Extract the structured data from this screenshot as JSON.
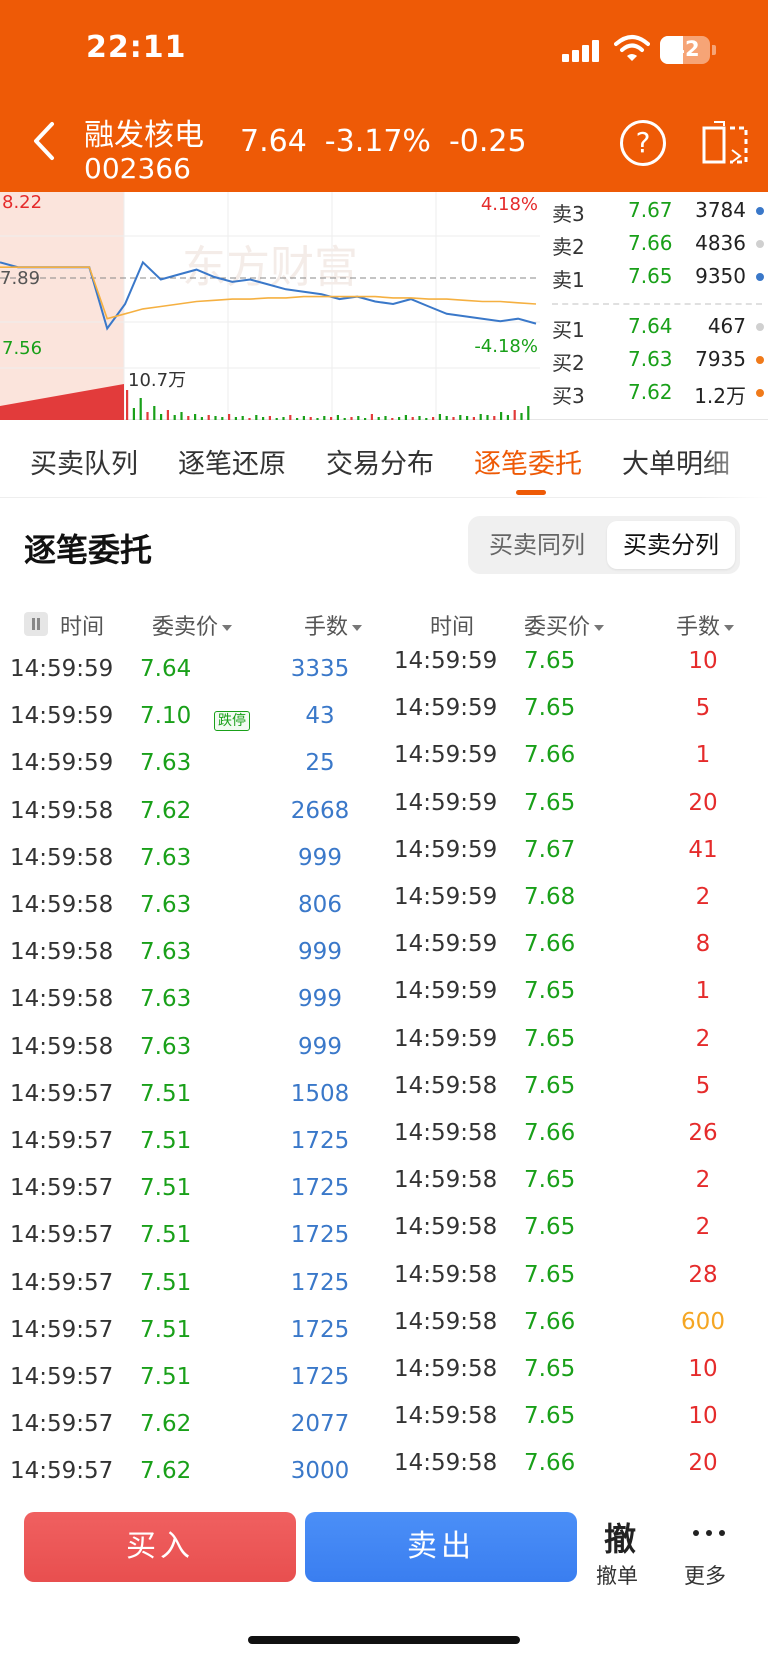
{
  "status_bar": {
    "time": "22:11",
    "battery": "42"
  },
  "header": {
    "stock_name": "融发核电",
    "stock_code": "002366",
    "price": "7.64",
    "change_pct": "-3.17%",
    "change": "-0.25",
    "help_label": "?"
  },
  "mini_chart": {
    "high_price": "8.22",
    "prev_close": "7.89",
    "low_price": "7.56",
    "high_pct": "4.18%",
    "low_pct": "-4.18%",
    "volume_label": "10.7万",
    "watermark": "东方财富"
  },
  "chart_data": {
    "type": "line",
    "ylim": [
      7.56,
      8.22
    ],
    "series": [
      {
        "values": [
          7.95,
          7.93,
          7.93,
          7.93,
          7.93,
          7.93,
          7.68,
          7.78,
          7.95,
          7.88,
          7.9,
          7.92,
          7.89,
          7.87,
          7.88,
          7.86,
          7.84,
          7.83,
          7.82,
          7.8,
          7.81,
          7.79,
          7.78,
          7.8,
          7.77,
          7.74,
          7.73,
          7.72,
          7.71,
          7.72,
          7.7
        ]
      },
      {
        "values": [
          7.93,
          7.93,
          7.93,
          7.93,
          7.93,
          7.93,
          7.72,
          7.74,
          7.76,
          7.77,
          7.78,
          7.79,
          7.795,
          7.8,
          7.8,
          7.805,
          7.805,
          7.81,
          7.81,
          7.81,
          7.81,
          7.81,
          7.805,
          7.805,
          7.8,
          7.8,
          7.795,
          7.79,
          7.79,
          7.785,
          7.78
        ]
      }
    ]
  },
  "order_book": {
    "asks": [
      {
        "label": "卖3",
        "price": "7.67",
        "volume": "3784",
        "dot": "#3a78c9"
      },
      {
        "label": "卖2",
        "price": "7.66",
        "volume": "4836",
        "dot": "#d0d0d0"
      },
      {
        "label": "卖1",
        "price": "7.65",
        "volume": "9350",
        "dot": "#3a78c9"
      }
    ],
    "bids": [
      {
        "label": "买1",
        "price": "7.64",
        "volume": "467",
        "dot": "#d0d0d0"
      },
      {
        "label": "买2",
        "price": "7.63",
        "volume": "7935",
        "dot": "#f07a1a"
      },
      {
        "label": "买3",
        "price": "7.62",
        "volume": "1.2万",
        "dot": "#f07a1a"
      }
    ]
  },
  "tabs": [
    {
      "label": "买卖队列"
    },
    {
      "label": "逐笔还原"
    },
    {
      "label": "交易分布"
    },
    {
      "label": "逐笔委托"
    },
    {
      "label": "大单明细"
    }
  ],
  "section": {
    "title": "逐笔委托",
    "toggle": [
      "买卖同列",
      "买卖分列"
    ]
  },
  "columns": {
    "left": [
      "时间",
      "委卖价",
      "手数"
    ],
    "right": [
      "时间",
      "委买价",
      "手数"
    ]
  },
  "limit_badge": "跌停",
  "sell_orders": [
    {
      "time": "14:59:59",
      "price": "7.64",
      "volume": "3335"
    },
    {
      "time": "14:59:59",
      "price": "7.10",
      "volume": "43"
    },
    {
      "time": "14:59:59",
      "price": "7.63",
      "volume": "25"
    },
    {
      "time": "14:59:58",
      "price": "7.62",
      "volume": "2668"
    },
    {
      "time": "14:59:58",
      "price": "7.63",
      "volume": "999"
    },
    {
      "time": "14:59:58",
      "price": "7.63",
      "volume": "806"
    },
    {
      "time": "14:59:58",
      "price": "7.63",
      "volume": "999"
    },
    {
      "time": "14:59:58",
      "price": "7.63",
      "volume": "999"
    },
    {
      "time": "14:59:58",
      "price": "7.63",
      "volume": "999"
    },
    {
      "time": "14:59:57",
      "price": "7.51",
      "volume": "1508"
    },
    {
      "time": "14:59:57",
      "price": "7.51",
      "volume": "1725"
    },
    {
      "time": "14:59:57",
      "price": "7.51",
      "volume": "1725"
    },
    {
      "time": "14:59:57",
      "price": "7.51",
      "volume": "1725"
    },
    {
      "time": "14:59:57",
      "price": "7.51",
      "volume": "1725"
    },
    {
      "time": "14:59:57",
      "price": "7.51",
      "volume": "1725"
    },
    {
      "time": "14:59:57",
      "price": "7.51",
      "volume": "1725"
    },
    {
      "time": "14:59:57",
      "price": "7.62",
      "volume": "2077"
    },
    {
      "time": "14:59:57",
      "price": "7.62",
      "volume": "3000"
    }
  ],
  "buy_orders": [
    {
      "time": "14:59:59",
      "price": "7.65",
      "volume": "10"
    },
    {
      "time": "14:59:59",
      "price": "7.65",
      "volume": "5"
    },
    {
      "time": "14:59:59",
      "price": "7.66",
      "volume": "1"
    },
    {
      "time": "14:59:59",
      "price": "7.65",
      "volume": "20"
    },
    {
      "time": "14:59:59",
      "price": "7.67",
      "volume": "41"
    },
    {
      "time": "14:59:59",
      "price": "7.68",
      "volume": "2"
    },
    {
      "time": "14:59:59",
      "price": "7.66",
      "volume": "8"
    },
    {
      "time": "14:59:59",
      "price": "7.65",
      "volume": "1"
    },
    {
      "time": "14:59:59",
      "price": "7.65",
      "volume": "2"
    },
    {
      "time": "14:59:58",
      "price": "7.65",
      "volume": "5"
    },
    {
      "time": "14:59:58",
      "price": "7.66",
      "volume": "26"
    },
    {
      "time": "14:59:58",
      "price": "7.65",
      "volume": "2"
    },
    {
      "time": "14:59:58",
      "price": "7.65",
      "volume": "2"
    },
    {
      "time": "14:59:58",
      "price": "7.65",
      "volume": "28"
    },
    {
      "time": "14:59:58",
      "price": "7.66",
      "volume": "600"
    },
    {
      "time": "14:59:58",
      "price": "7.65",
      "volume": "10"
    },
    {
      "time": "14:59:58",
      "price": "7.65",
      "volume": "10"
    },
    {
      "time": "14:59:58",
      "price": "7.66",
      "volume": "20"
    }
  ],
  "colors": {
    "brand": "#ee5a06",
    "up_red": "#e52b2b",
    "down_green": "#19a019",
    "sell_volume_blue": "#3a78c9",
    "large_order_orange": "#f5a623"
  },
  "bottom_bar": {
    "buy_label": "买入",
    "sell_label": "卖出",
    "cancel_glyph": "撤",
    "cancel_label": "撤单",
    "more_label": "更多"
  }
}
